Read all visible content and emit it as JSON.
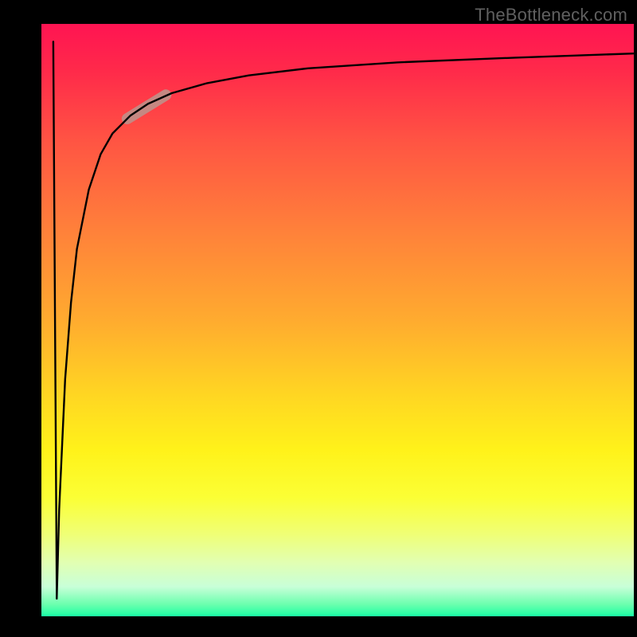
{
  "watermark": "TheBottleneck.com",
  "chart_data": {
    "type": "line",
    "title": "",
    "xlabel": "",
    "ylabel": "",
    "xlim": [
      0,
      100
    ],
    "ylim": [
      0,
      100
    ],
    "background_gradient": {
      "direction": "vertical",
      "stops": [
        {
          "pos": 0.0,
          "color": "#ff1452"
        },
        {
          "pos": 0.35,
          "color": "#ff813a"
        },
        {
          "pos": 0.7,
          "color": "#fff21a"
        },
        {
          "pos": 0.95,
          "color": "#c8ffd8"
        },
        {
          "pos": 1.0,
          "color": "#1affa4"
        }
      ]
    },
    "series": [
      {
        "name": "vertical-drop",
        "x": [
          2.0,
          2.6
        ],
        "values": [
          97,
          3
        ],
        "stroke": "#000000"
      },
      {
        "name": "main-curve",
        "x": [
          2.6,
          3,
          4,
          5,
          6,
          8,
          10,
          12,
          15,
          18,
          22,
          28,
          35,
          45,
          60,
          80,
          100
        ],
        "values": [
          3,
          18,
          40,
          53,
          62,
          72,
          78,
          81.5,
          84.5,
          86.5,
          88.3,
          90,
          91.3,
          92.5,
          93.5,
          94.3,
          95
        ],
        "stroke": "#000000"
      }
    ],
    "highlight": {
      "name": "marker-segment",
      "x_start": 14.5,
      "x_end": 21,
      "y_start": 84,
      "y_end": 88,
      "color": "#c58882",
      "thickness": 14
    }
  }
}
